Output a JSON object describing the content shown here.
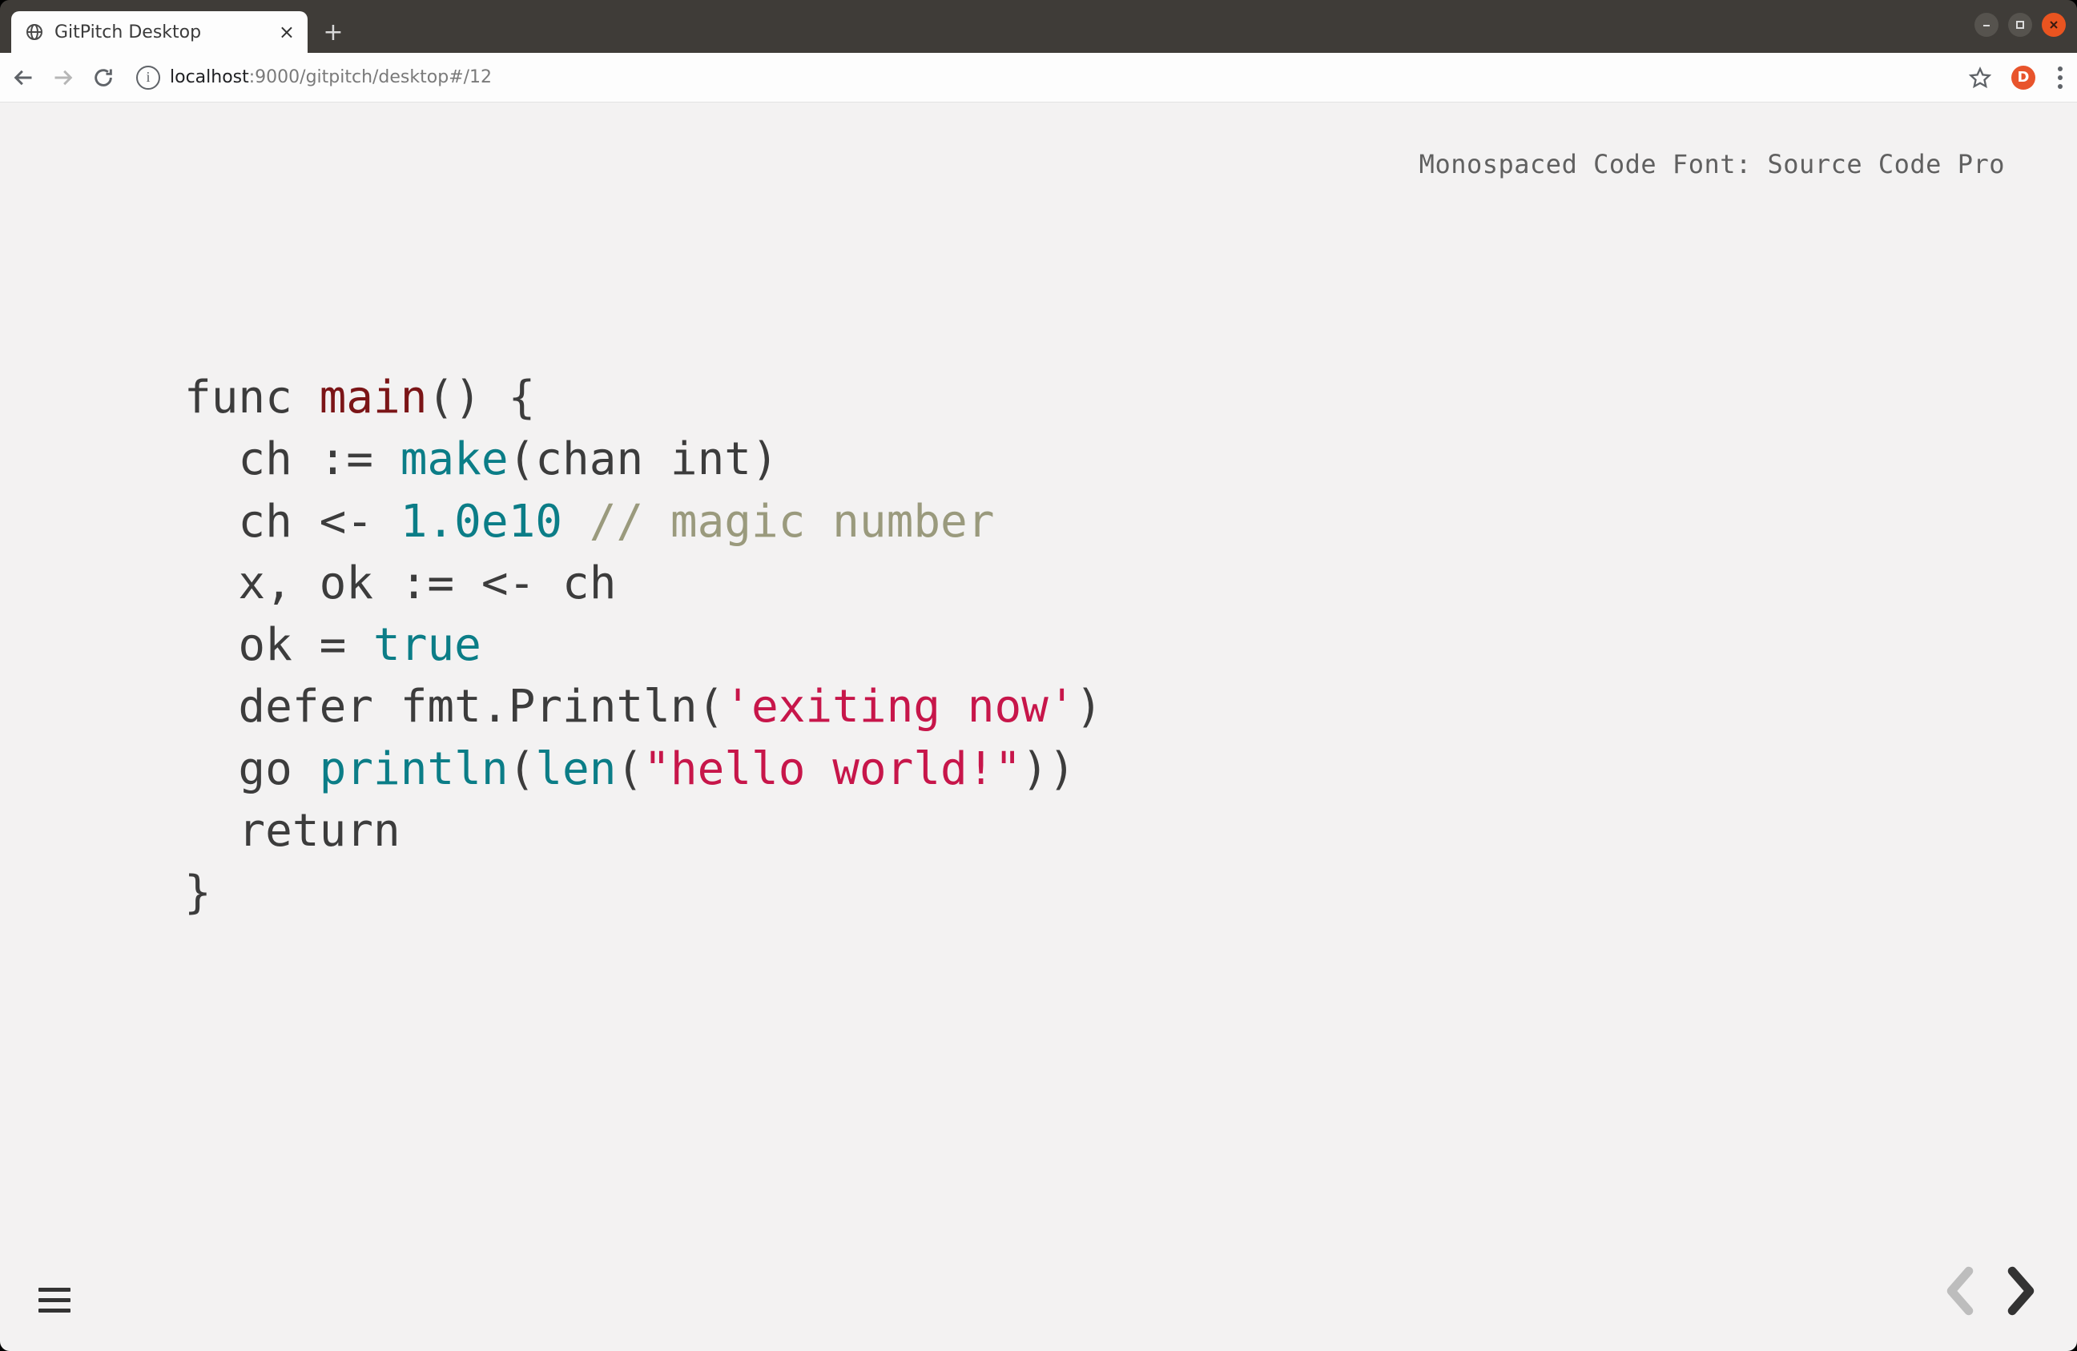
{
  "browser": {
    "tab_title": "GitPitch Desktop",
    "url_host": "localhost",
    "url_path": ":9000/gitpitch/desktop#/12",
    "avatar_initial": "D"
  },
  "slide": {
    "header": "Monospaced Code Font: Source Code Pro"
  },
  "code": {
    "l0a": "func ",
    "l0b": "main",
    "l0c": "() {",
    "l1a": "  ch := ",
    "l1b": "make",
    "l1c": "(chan int)",
    "l2a": "  ch <- ",
    "l2b": "1.0e10",
    "l2c": " ",
    "l2d": "// magic number",
    "l3": "  x, ok := <- ch",
    "l4a": "  ok = ",
    "l4b": "true",
    "l5a": "  defer fmt.Println(",
    "l5b": "'exiting now'",
    "l5c": ")",
    "l6a": "  go ",
    "l6b": "println",
    "l6c": "(",
    "l6d": "len",
    "l6e": "(",
    "l6f": "\"hello world!\"",
    "l6g": "))",
    "l7": "  return",
    "l8": "}"
  }
}
